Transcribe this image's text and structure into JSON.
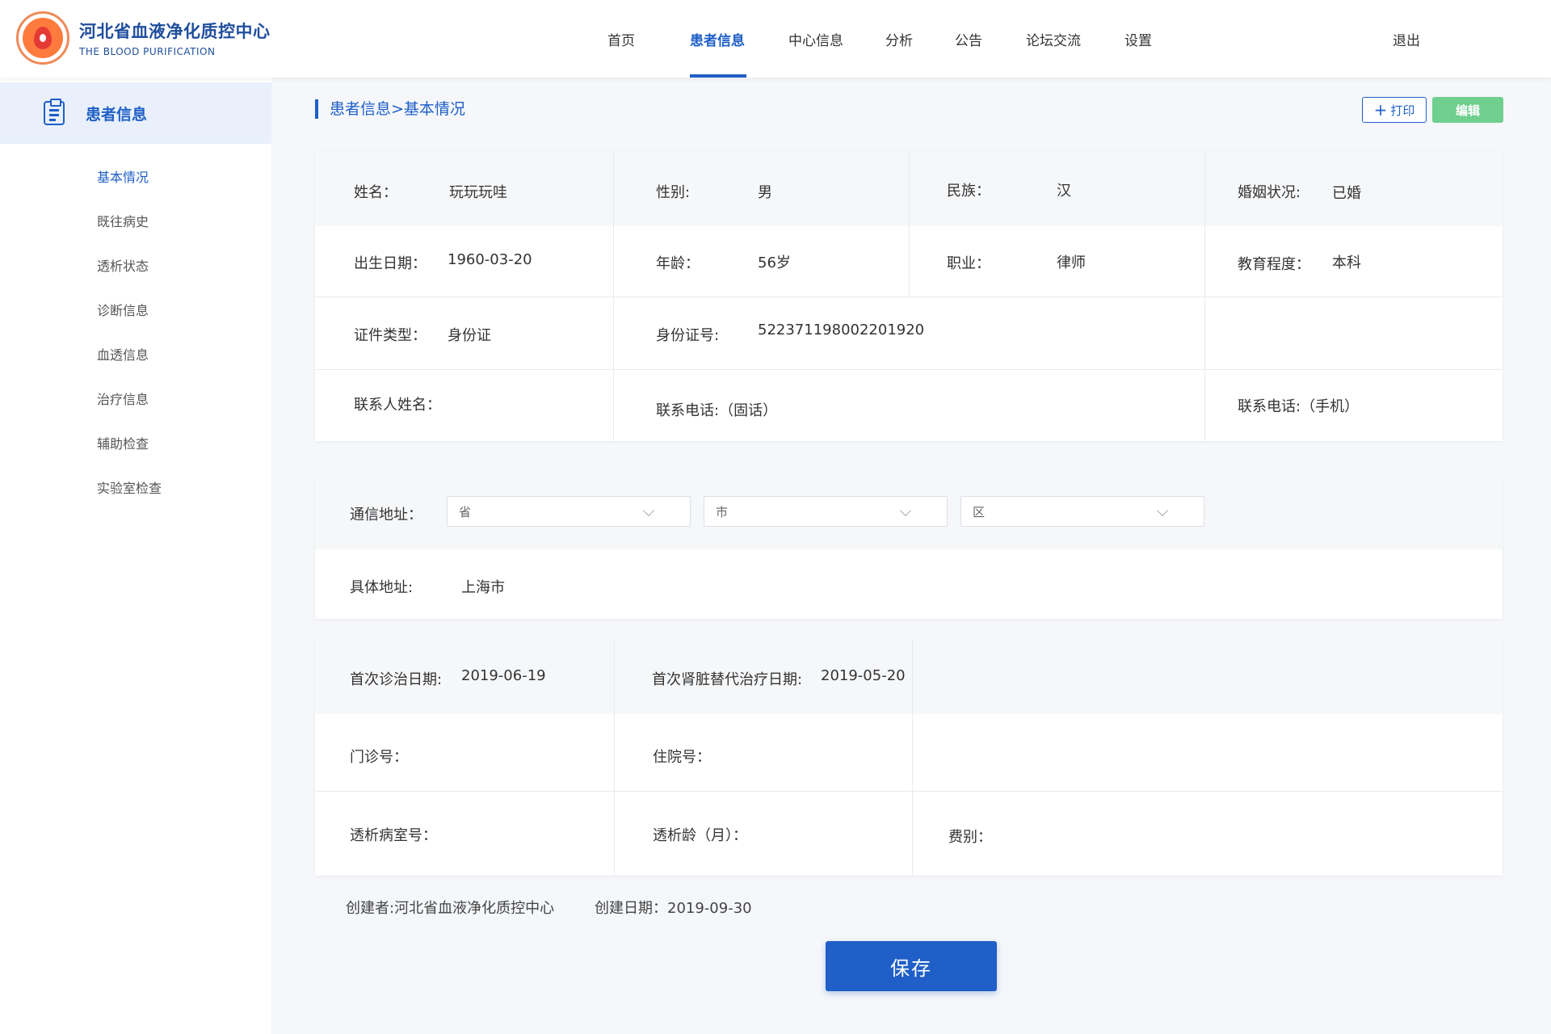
{
  "header": {
    "logo_title": "河北省血液净化质控中心",
    "logo_sub": "THE BLOOD PURIFICATION",
    "nav": [
      {
        "label": "首页"
      },
      {
        "label": "患者信息"
      },
      {
        "label": "中心信息"
      },
      {
        "label": "分析"
      },
      {
        "label": "公告"
      },
      {
        "label": "论坛交流"
      },
      {
        "label": "设置"
      }
    ],
    "active_nav": "患者信息",
    "logout": "退出"
  },
  "sidebar": {
    "title": "患者信息",
    "items": [
      {
        "label": "基本情况"
      },
      {
        "label": "既往病史"
      },
      {
        "label": "透析状态"
      },
      {
        "label": "诊断信息"
      },
      {
        "label": "血透信息"
      },
      {
        "label": "治疗信息"
      },
      {
        "label": "辅助检查"
      },
      {
        "label": "实验室检查"
      }
    ],
    "active_item": "基本情况"
  },
  "main": {
    "breadcrumb": "患者信息>基本情况",
    "print_label": "打印",
    "edit_label": "编辑",
    "basic": {
      "name_label": "姓名：",
      "name": "玩玩玩哇",
      "gender_label": "性别:",
      "gender": "男",
      "ethnicity_label": "民族：",
      "ethnicity": "汉",
      "marital_label": "婚姻状况:",
      "marital": "已婚",
      "birth_label": "出生日期：",
      "birth": "1960-03-20",
      "age_label": "年龄：",
      "age": "56岁",
      "job_label": "职业：",
      "job": "律师",
      "edu_label": "教育程度：",
      "edu": "本科",
      "idtype_label": "证件类型：",
      "idtype": "身份证",
      "idno_label": "身份证号:",
      "idno": "522371198002201920",
      "contact_label": "联系人姓名：",
      "phone_fixed_label": "联系电话:（固话）",
      "phone_mobile_label": "联系电话:（手机）"
    },
    "address": {
      "mail_label": "通信地址：",
      "province_placeholder": "省",
      "city_placeholder": "市",
      "district_placeholder": "区",
      "detail_label": "具体地址:",
      "detail": "上海市"
    },
    "treatment": {
      "first_visit_label": "首次诊治日期:",
      "first_visit": "2019-06-19",
      "first_rrt_label": "首次肾脏替代治疗日期:",
      "first_rrt": "2019-05-20",
      "outpatient_label": "门诊号：",
      "inpatient_label": "住院号：",
      "ward_label": "透析病室号：",
      "dialysis_age_label": "透析龄（月）：",
      "fee_label": "费别："
    },
    "creator": "创建者:河北省血液净化质控中心",
    "created_date": "创建日期：2019-09-30",
    "save_label": "保存"
  }
}
